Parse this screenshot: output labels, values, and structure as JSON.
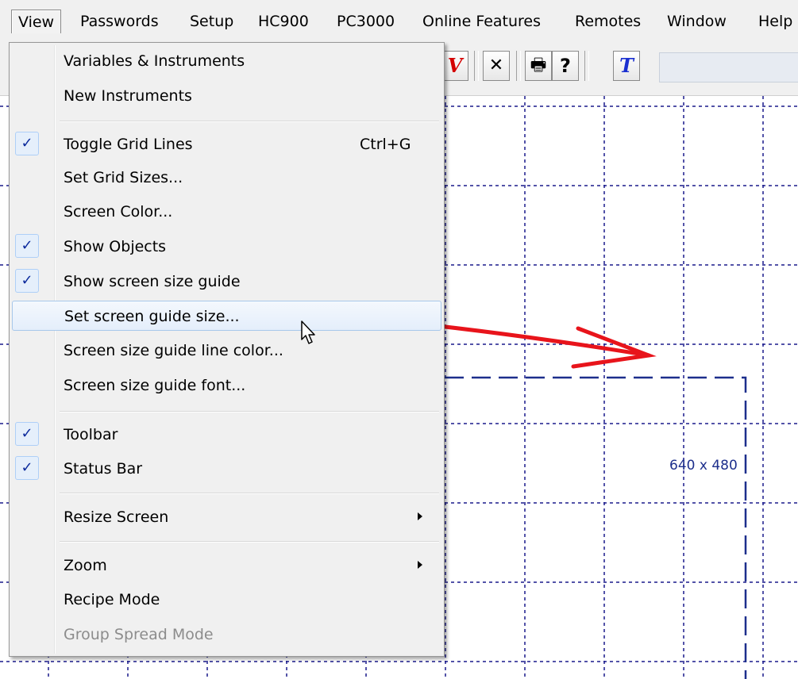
{
  "menubar": {
    "items": [
      {
        "label": "View"
      },
      {
        "label": "Passwords"
      },
      {
        "label": "Setup"
      },
      {
        "label": "HC900"
      },
      {
        "label": "PC3000"
      },
      {
        "label": "Online Features"
      },
      {
        "label": "Remotes"
      },
      {
        "label": "Window"
      },
      {
        "label": "Help"
      }
    ]
  },
  "toolbar": {
    "buttons": [
      {
        "icon": "red-v-icon",
        "glyph": "V",
        "color": "#d40000"
      },
      {
        "icon": "tools-icon",
        "glyph": "✕"
      },
      {
        "icon": "print-icon",
        "glyph": "🖶"
      },
      {
        "icon": "help-icon",
        "glyph": "?"
      },
      {
        "icon": "text-t-icon",
        "glyph": "T",
        "color": "#1a2fd0"
      }
    ]
  },
  "view_menu": {
    "items": [
      {
        "label": "Variables & Instruments"
      },
      {
        "label": "New Instruments"
      },
      {
        "label": "Toggle Grid Lines",
        "checked": true,
        "shortcut": "Ctrl+G"
      },
      {
        "label": "Set Grid Sizes..."
      },
      {
        "label": "Screen Color..."
      },
      {
        "label": "Show Objects",
        "checked": true
      },
      {
        "label": "Show screen size guide",
        "checked": true
      },
      {
        "label": "Set screen guide size...",
        "highlighted": true
      },
      {
        "label": "Screen size guide line color..."
      },
      {
        "label": "Screen size guide font..."
      },
      {
        "label": "Toolbar",
        "checked": true
      },
      {
        "label": "Status Bar",
        "checked": true
      },
      {
        "label": "Resize Screen",
        "submenu": true
      },
      {
        "label": "Zoom",
        "submenu": true
      },
      {
        "label": "Recipe Mode"
      },
      {
        "label": "Group Spread Mode",
        "disabled": true
      }
    ],
    "check_glyph": "✓"
  },
  "canvas": {
    "guide_label": "640 x 480",
    "grid_color": "#1a1a8c",
    "annotation_color": "#e8141b"
  }
}
